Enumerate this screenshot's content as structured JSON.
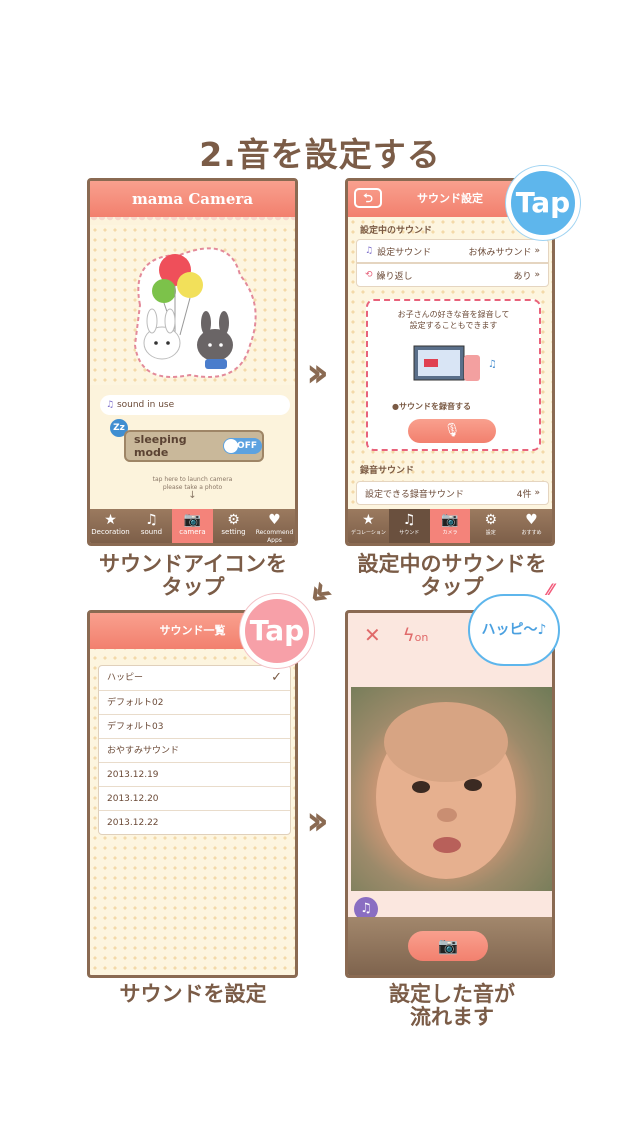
{
  "title": "2.音を設定する",
  "captions": {
    "p1": "サウンドアイコンを\nタップ",
    "p2": "設定中のサウンドを\nタップ",
    "p3": "サウンドを設定",
    "p4": "設定した音が\n流れます"
  },
  "tap_label": "Tap",
  "happy_label": "ハッピ〜♪",
  "p1": {
    "app_title": "mama Camera",
    "sound_in_use": "sound in use",
    "sleeping_mode": "sleeping mode",
    "toggle": "OFF",
    "hint1": "tap here to launch camera",
    "hint2": "please take a photo",
    "tabs": [
      "Decoration",
      "sound",
      "camera",
      "setting",
      "Recommend Apps"
    ]
  },
  "p2": {
    "header": "サウンド設定",
    "section1": "設定中のサウンド",
    "row1_label": "設定サウンド",
    "row1_value": "お休みサウンド",
    "row2_label": "繰り返し",
    "row2_value": "あり",
    "promo1": "お子さんの好きな音を録音して",
    "promo2": "設定することもできます",
    "record_label": "●サウンドを録音する",
    "section2": "録音サウンド",
    "row3_label": "設定できる録音サウンド",
    "row3_value": "4件",
    "tabs": [
      "デコレーション",
      "サウンド",
      "カメラ",
      "設定",
      "おすすめ"
    ]
  },
  "p3": {
    "header": "サウンド一覧",
    "items": [
      "ハッピー",
      "デフォルト02",
      "デフォルト03",
      "おやすみサウンド",
      "2013.12.19",
      "2013.12.20",
      "2013.12.22"
    ]
  },
  "p4": {
    "flash": "on"
  }
}
